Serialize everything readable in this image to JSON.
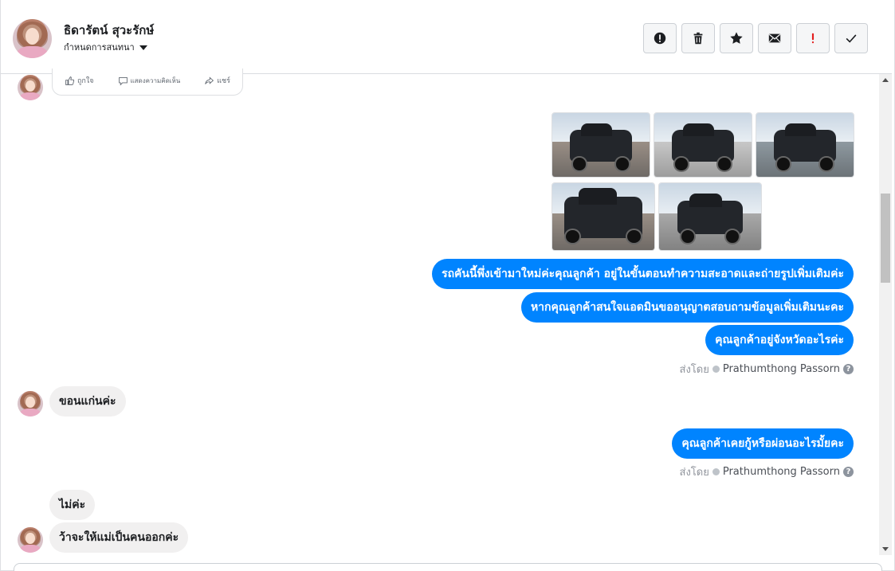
{
  "header": {
    "contact_name": "ธิดารัตน์ สุวะรักษ์",
    "assign_label": "กำหนดการสนทนา",
    "toolbar": [
      {
        "name": "report-spam-button",
        "icon": "alert-circle-icon"
      },
      {
        "name": "delete-button",
        "icon": "trash-icon"
      },
      {
        "name": "star-button",
        "icon": "star-icon"
      },
      {
        "name": "mark-unread-button",
        "icon": "envelope-icon"
      },
      {
        "name": "follow-up-button",
        "icon": "exclamation-icon"
      },
      {
        "name": "mark-done-button",
        "icon": "check-icon"
      }
    ]
  },
  "shared_post": {
    "like_label": "ถูกใจ",
    "comment_label": "แสดงความคิดเห็น",
    "share_label": "แชร์"
  },
  "messages": {
    "out_1": "รถคันนี้พึ่งเข้ามาใหม่ค่ะคุณลูกค้า อยู่ในขั้นตอนทำความสะอาดและถ่ายรูปเพิ่มเติมค่ะ",
    "out_2": "หากคุณลูกค้าสนใจแอดมินขออนุญาตสอบถามข้อมูลเพิ่มเติมนะคะ",
    "out_3": "คุณลูกค้าอยู่จังหวัดอะไรค่ะ",
    "in_1": "ขอนแก่นค่ะ",
    "out_4": "คุณลูกค้าเคยกู้หรือผ่อนอะไรมั้ยคะ",
    "in_2": "ไม่ค่ะ",
    "in_3": "ว้าจะให้แม่เป็นคนออกค่ะ"
  },
  "sent_by": {
    "label": "ส่งโดย",
    "sender": "Prathumthong Passorn"
  },
  "colors": {
    "outgoing_bubble": "#0084ff",
    "incoming_bubble": "#f1f0f0",
    "follow_up_accent": "#e41e1e"
  }
}
